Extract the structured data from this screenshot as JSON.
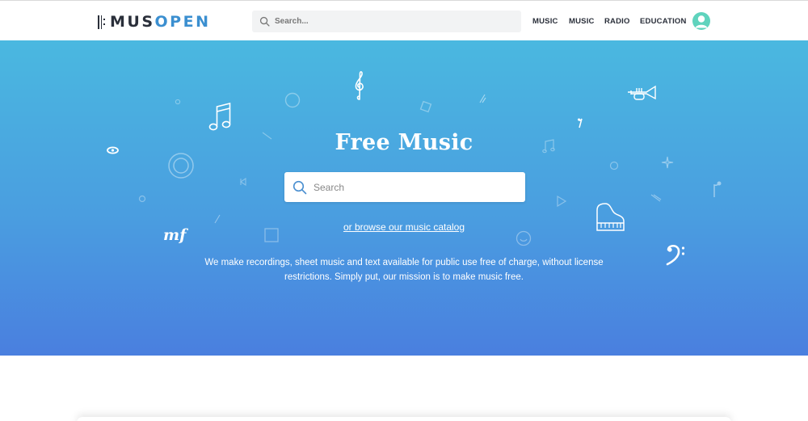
{
  "header": {
    "logo_text_a": "MUS",
    "logo_text_b": "OPEN",
    "search_placeholder": "Search...",
    "nav": [
      "MUSIC",
      "MUSIC",
      "RADIO",
      "EDUCATION"
    ]
  },
  "hero": {
    "title": "Free Music",
    "search_placeholder": "Search",
    "browse_link": "or browse our music catalog",
    "mission": "We make recordings, sheet music and text available for public use free of charge, without license restrictions. Simply put, our mission is to make music free.",
    "decorations": [
      "treble-clef-icon",
      "double-note-icon",
      "trumpet-icon",
      "piano-icon",
      "bass-clef-icon",
      "mezzo-forte-icon",
      "eighth-rest-icon"
    ],
    "mf_text": "mf"
  },
  "colors": {
    "brand_dark": "#2a2f3a",
    "brand_blue": "#3b8fd0",
    "hero_top": "#4ab8e0",
    "hero_bottom": "#4a7fdf",
    "avatar": "#5fd3bd"
  }
}
